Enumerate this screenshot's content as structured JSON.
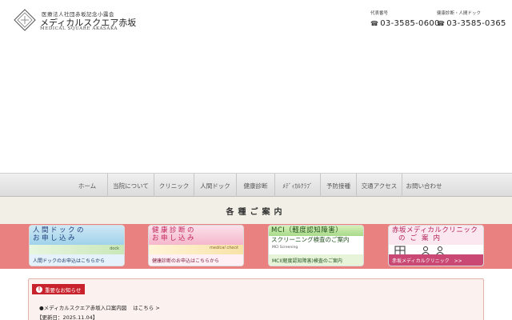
{
  "header": {
    "logo_sub": "医療法人社団赤坂記念小露会",
    "logo_name": "メディカルスクエア赤坂",
    "logo_en": "MEDICAL SQUARE AKASAKA",
    "tel_main_label": "代表番号",
    "tel_main": "03-3585-0600",
    "tel_checkup_label": "健康診断・人間ドック",
    "tel_checkup": "03-3585-0365"
  },
  "nav": {
    "items": [
      "ホーム",
      "当院について",
      "クリニック",
      "人間ドック",
      "健康診断",
      "ﾒﾃﾞｨｶﾙｸﾗﾌﾞ",
      "予防接種",
      "交通アクセス",
      "お問い合わせ"
    ]
  },
  "guide": {
    "title": "各種ご案内"
  },
  "banners": [
    {
      "line1": "人間ドックの",
      "line2": "お申し込み",
      "tag": "dock",
      "foot": "人間ドックのお申込はこちらから"
    },
    {
      "line1": "健康診断の",
      "line2": "お申し込み",
      "tag": "medical check",
      "foot": "健康診断のお申込はこちらから"
    },
    {
      "line1": "MCI（軽度認知障害）",
      "line2": "スクリーニング検査のご案内",
      "tag": "MCI Screening",
      "foot": "MCI(軽度認知障害)検査のご案内"
    },
    {
      "line1": "赤坂メディカルクリニック",
      "line2": "のご案内",
      "foot": "赤坂メディカルクリニック　>>"
    }
  ],
  "notice": {
    "tag": "重要なお知らせ",
    "line1_prefix": "●メディカルスクエア赤坂入口案内図",
    "line1_link": "はこちら >",
    "line2": "【更新日：2025.11.04】"
  },
  "colors": {
    "band": "#e8817f",
    "notice_tag": "#c8232c",
    "guide_band": "#f2efe6"
  }
}
